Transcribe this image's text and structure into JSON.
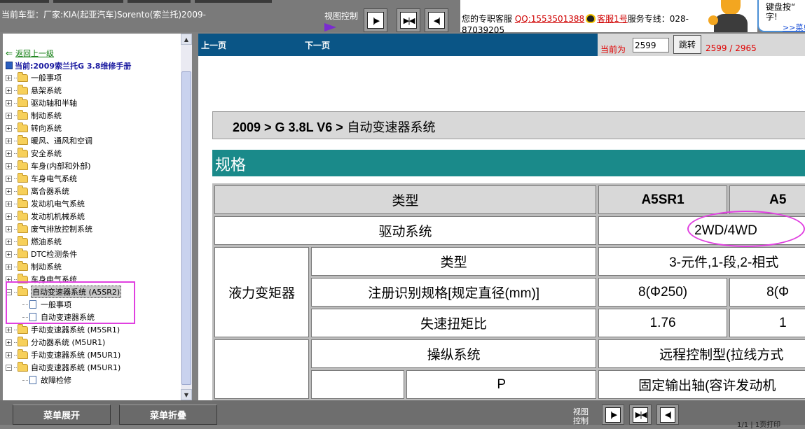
{
  "header": {
    "car_info": "当前车型：厂家:KIA(起亚汽车)Sorento(索兰托)2009-",
    "view_control_label": "视图控制",
    "service_label": "您的专职客服",
    "qq": "QQ:1553501388",
    "agent": "客服1号",
    "hotline_label": "服务专线：028-",
    "hotline_cont": "87039205",
    "bubble_line1": "键盘按“",
    "bubble_line2": "字!",
    "bubble_link": ">>菜单"
  },
  "sidebar": {
    "back_link": "返回上一级",
    "current": "当前:2009索兰托G 3.8维修手册",
    "items": [
      {
        "label": "一般事项",
        "state": "+"
      },
      {
        "label": "悬架系统",
        "state": "+"
      },
      {
        "label": "驱动轴和半轴",
        "state": "+"
      },
      {
        "label": "制动系统",
        "state": "+"
      },
      {
        "label": "转向系统",
        "state": "+"
      },
      {
        "label": "暖风、通风和空调",
        "state": "+"
      },
      {
        "label": "安全系统",
        "state": "+"
      },
      {
        "label": "车身(内部和外部)",
        "state": "+"
      },
      {
        "label": "车身电气系统",
        "state": "+"
      },
      {
        "label": "离合器系统",
        "state": "+"
      },
      {
        "label": "发动机电气系统",
        "state": "+"
      },
      {
        "label": "发动机机械系统",
        "state": "+"
      },
      {
        "label": "废气排放控制系统",
        "state": "+"
      },
      {
        "label": "燃油系统",
        "state": "+"
      },
      {
        "label": "DTC检测条件",
        "state": "+"
      },
      {
        "label": "制动系统",
        "state": "+"
      },
      {
        "label": "车身电气系统",
        "state": "+"
      },
      {
        "label": "自动变速器系统 (A5SR2)",
        "state": "−"
      },
      {
        "label": "手动变速器系统 (M5SR1)",
        "state": "+"
      },
      {
        "label": "分动器系统 (M5UR1)",
        "state": "+"
      },
      {
        "label": "手动变速器系统 (M5UR1)",
        "state": "+"
      },
      {
        "label": "自动变速器系统 (M5UR1)",
        "state": "−"
      }
    ],
    "children_a5sr2": [
      "一般事项",
      "自动变速器系统"
    ],
    "children_m5ur1": [
      "故障检修"
    ]
  },
  "pager": {
    "prev": "上一页",
    "next": "下一页",
    "current_label": "当前为",
    "page_value": "2599",
    "jump_label": "跳转",
    "page_count": "2599 / 2965"
  },
  "doc": {
    "breadcrumb_bold": "2009 > G 3.8L V6 >",
    "breadcrumb_tail": " 自动变速器系统",
    "section_title": "规格",
    "table": {
      "header_type": "类型",
      "col1": "A5SR1",
      "col2": "A5",
      "drive_label": "驱动系统",
      "drive_value": "2WD/4WD",
      "converter_label": "液力变矩器",
      "conv_type_label": "类型",
      "conv_type_value": "3-元件,1-段,2-相式",
      "conv_spec_label": "注册识别规格[规定直径(mm)]",
      "conv_spec_v1": "8(Φ250)",
      "conv_spec_v2": "8(Φ",
      "stall_label": "失速扭矩比",
      "stall_v1": "1.76",
      "stall_v2": "1",
      "control_label": "操纵系统",
      "control_value": "远程控制型(拉线方式",
      "p_label": "P",
      "p_value": "固定输出轴(容许发动机"
    }
  },
  "bottom": {
    "expand_menu": "菜单展开",
    "collapse_menu": "菜单折叠",
    "view_control_label": "视图控制",
    "page_info": "1/1 | 1页打印"
  },
  "colors": {
    "accent_teal": "#1a8a8a",
    "pager_blue": "#0a5586",
    "highlight_magenta": "#e040e0",
    "red_text": "#e00000"
  }
}
